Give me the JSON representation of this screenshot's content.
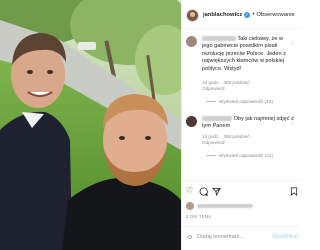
{
  "post": {
    "username": "janblachowicz",
    "follow_label": "Obserwowanie",
    "more_label": "•"
  },
  "comments": [
    {
      "text": "Taki ciekawy, że w jego gabinecie powstkim pisali rezolucję przeciw Polsce. Jeden z największych kłamców w polskiej polityce. Wstyd!",
      "meta_time": "1d godz.",
      "meta_likes": "398 polubień",
      "meta_reply": "Odpowiedz",
      "replies_label": "Wyświetl odpowiedzi (13)"
    },
    {
      "text": "Oby jak najmniej zdjęć z tym Panem",
      "meta_time": "1d godz.",
      "meta_likes": "286 polubień",
      "meta_reply": "Odpowiedz",
      "replies_label": "Wyświetl odpowiedzi (24)"
    }
  ],
  "actions": {
    "like_icon": "heart-icon",
    "comment_icon": "comment-icon",
    "share_icon": "share-icon",
    "save_icon": "bookmark-icon"
  },
  "timestamp": "2 DNI TEMU",
  "add_comment": {
    "placeholder": "Dodaj komentarz...",
    "publish_label": "Opublikuj"
  }
}
